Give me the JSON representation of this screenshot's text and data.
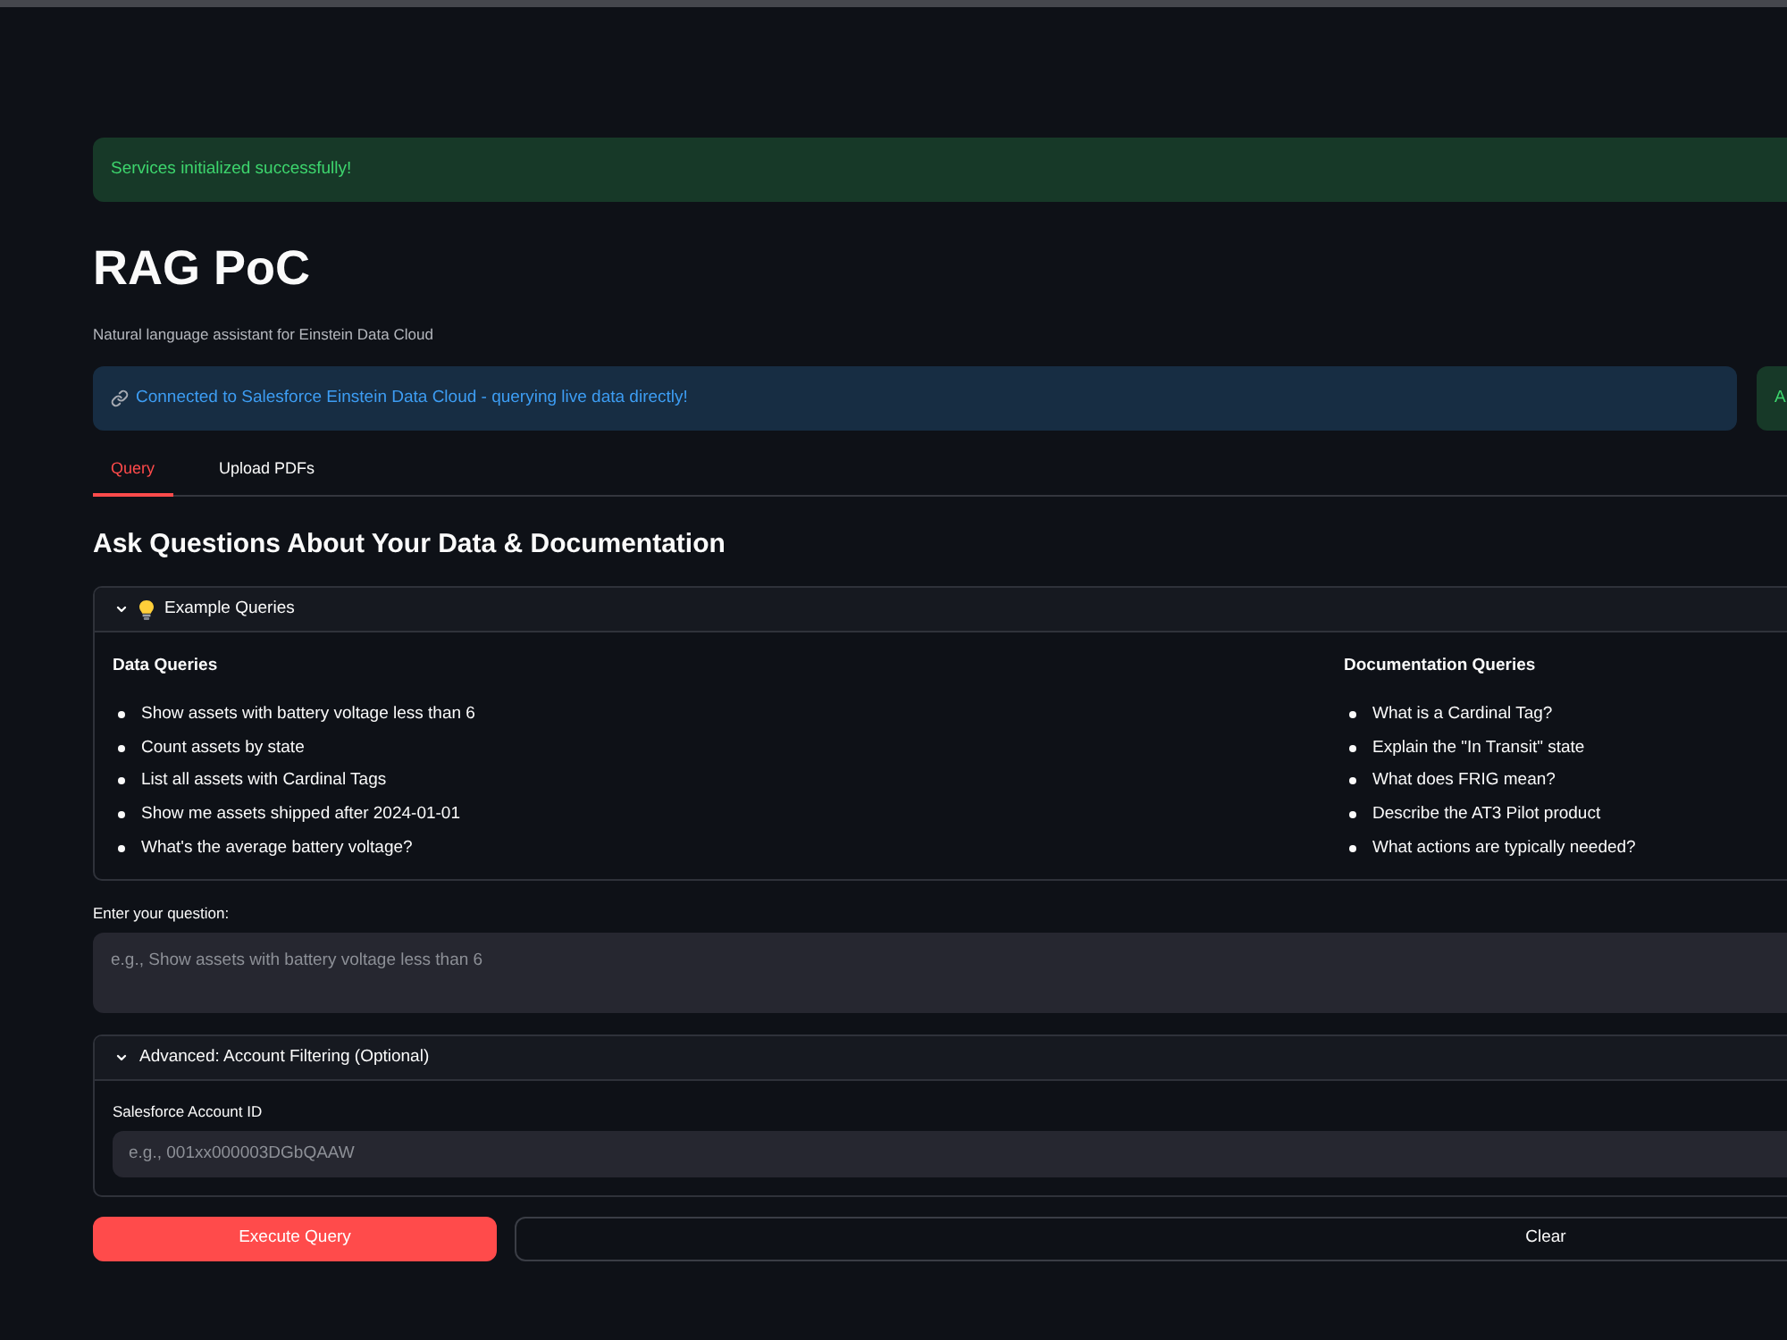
{
  "success_banner": {
    "kind": "success",
    "text": "Services initialized successfully!"
  },
  "header": {
    "title": "RAG PoC",
    "subtitle": "Natural language assistant for Einstein Data Cloud"
  },
  "status_alerts": [
    {
      "kind": "info",
      "text": "Connected to Salesforce Einstein Data Cloud - querying live data directly!"
    },
    {
      "kind": "success",
      "text": "A"
    }
  ],
  "tabs": [
    {
      "label": "Query",
      "selected": true
    },
    {
      "label": "Upload PDFs",
      "selected": false
    }
  ],
  "section_title": "Ask Questions About Your Data & Documentation",
  "examples": {
    "title": "Example Queries",
    "expanded": true,
    "columns": [
      {
        "heading": "Data Queries",
        "items": [
          "Show assets with battery voltage less than 6",
          "Count assets by state",
          "List all assets with Cardinal Tags",
          "Show me assets shipped after 2024-01-01",
          "What's the average battery voltage?"
        ]
      },
      {
        "heading": "Documentation Queries",
        "items": [
          "What is a Cardinal Tag?",
          "Explain the \"In Transit\" state",
          "What does FRIG mean?",
          "Describe the AT3 Pilot product",
          "What actions are typically needed?"
        ]
      }
    ]
  },
  "question": {
    "label": "Enter your question:",
    "placeholder": "e.g., Show assets with battery voltage less than 6"
  },
  "advanced": {
    "title": "Advanced: Account Filtering (Optional)",
    "expanded": true,
    "field": {
      "label": "Salesforce Account ID",
      "placeholder": "e.g., 001xx000003DGbQAAW"
    }
  },
  "buttons": [
    {
      "label": "Execute Query",
      "kind": "primary"
    },
    {
      "label": "Clear",
      "kind": "secondary"
    }
  ]
}
